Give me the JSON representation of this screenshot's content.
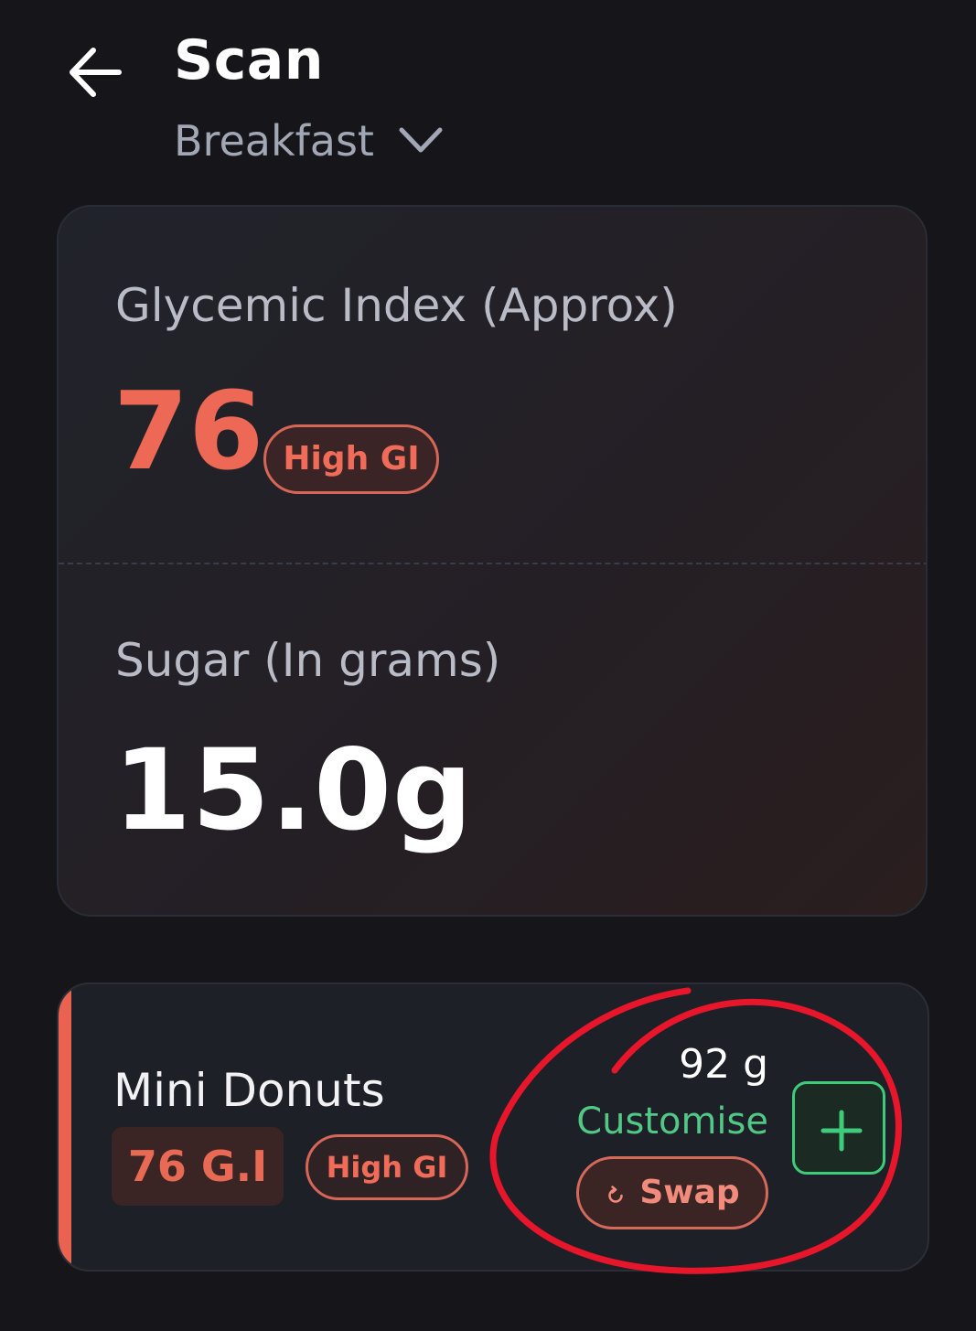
{
  "header": {
    "title": "Scan",
    "meal_selector": "Breakfast"
  },
  "summary": {
    "glycemic_index_label": "Glycemic Index (Approx)",
    "glycemic_index_value": "76",
    "glycemic_index_badge": "High GI",
    "sugar_label": "Sugar (In grams)",
    "sugar_value": "15.0g"
  },
  "food_item": {
    "name": "Mini Donuts",
    "gi_chip": "76 G.I",
    "gi_badge": "High GI",
    "weight": "92 g",
    "customise_label": "Customise",
    "swap_label": "Swap"
  },
  "colors": {
    "background": "#15151a",
    "high_gi_red": "#ed6955",
    "customise_green": "#52c887",
    "annotation_red": "#e8162a"
  },
  "icons": {
    "back": "back-arrow-icon",
    "meal_dropdown": "chevron-down-icon",
    "swap": "refresh-icon",
    "add": "plus-icon"
  }
}
